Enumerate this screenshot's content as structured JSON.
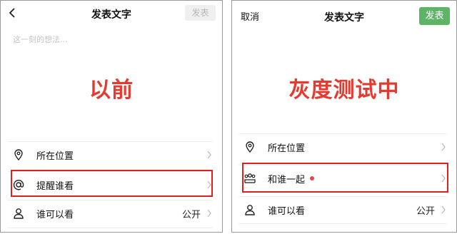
{
  "left": {
    "title": "发表文字",
    "publish_label": "发表",
    "placeholder": "这一刻的想法...",
    "big_label": "以前",
    "rows": [
      {
        "label": "所在位置",
        "value": ""
      },
      {
        "label": "提醒谁看",
        "value": ""
      },
      {
        "label": "谁可以看",
        "value": "公开"
      }
    ]
  },
  "right": {
    "cancel_label": "取消",
    "title": "发表文字",
    "publish_label": "发表",
    "big_label": "灰度测试中",
    "rows": [
      {
        "label": "所在位置",
        "value": ""
      },
      {
        "label": "和谁一起",
        "value": ""
      },
      {
        "label": "谁可以看",
        "value": "公开"
      }
    ]
  },
  "colors": {
    "accent_green": "#5db466",
    "highlight_red": "#e01f1f",
    "label_red": "#e53a2f",
    "new_dot": "#e0494a"
  },
  "icons": [
    "back-arrow-icon",
    "location-pin-icon",
    "at-sign-icon",
    "person-icon",
    "people-group-icon",
    "chevron-right-icon"
  ]
}
